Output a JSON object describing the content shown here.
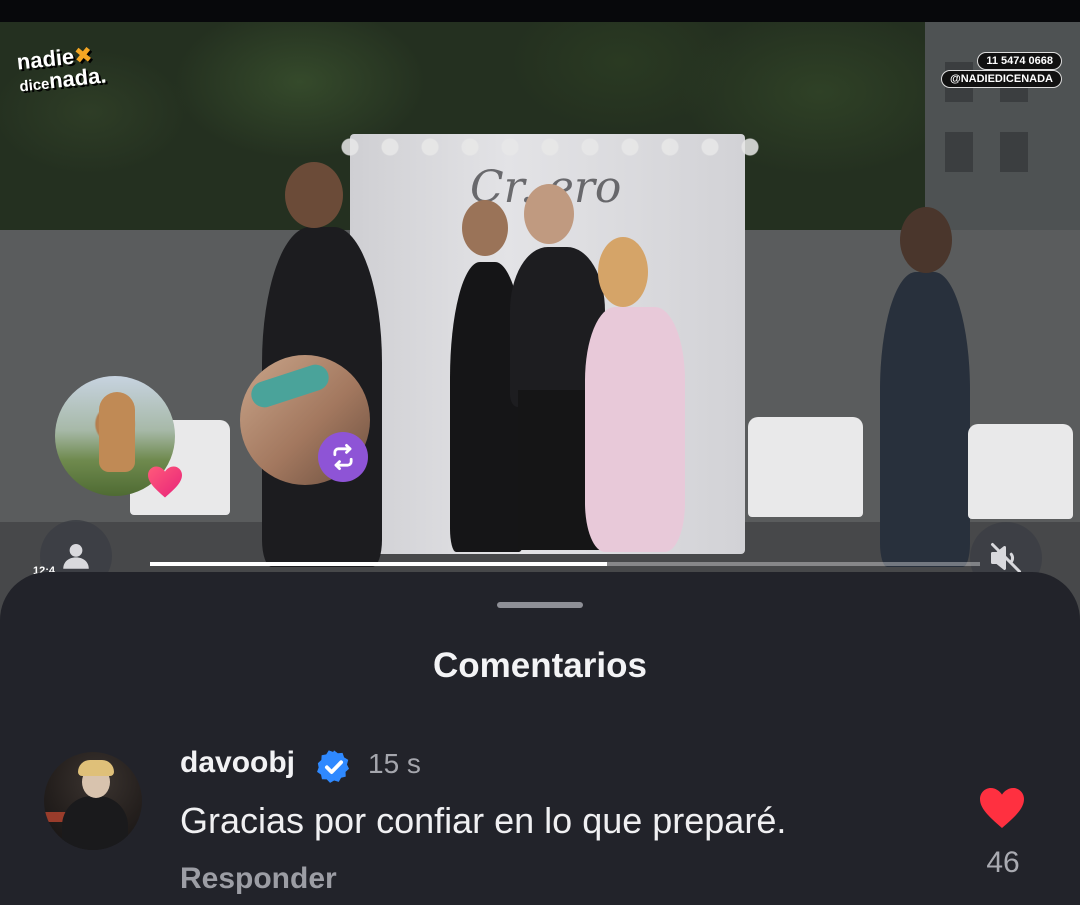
{
  "video": {
    "logo": {
      "line1": "nadie",
      "line2_small": "dice",
      "line2": "nada.",
      "mark": "✖"
    },
    "overlay_tags": {
      "phone": "11 5474 0668",
      "handle": "@NADIEDICENADA"
    },
    "sign_text": "Cr..ero",
    "clock_text": "12:4",
    "progress_fraction": 0.55
  },
  "sheet": {
    "title": "Comentarios"
  },
  "comment": {
    "username": "davoobj",
    "verified": true,
    "time": "15 s",
    "text": "Gracias por confiar en lo que preparé.",
    "reply_label": "Responder",
    "like_count": "46"
  },
  "colors": {
    "like_red": "#ff3040",
    "verified_blue": "#2f89ff",
    "repost_purple": "#8e54d6",
    "sheet_bg": "#22232a"
  },
  "icons": [
    "heart-icon",
    "repost-icon",
    "user-icon",
    "mute-icon",
    "verified-badge-icon",
    "like-heart-icon"
  ]
}
